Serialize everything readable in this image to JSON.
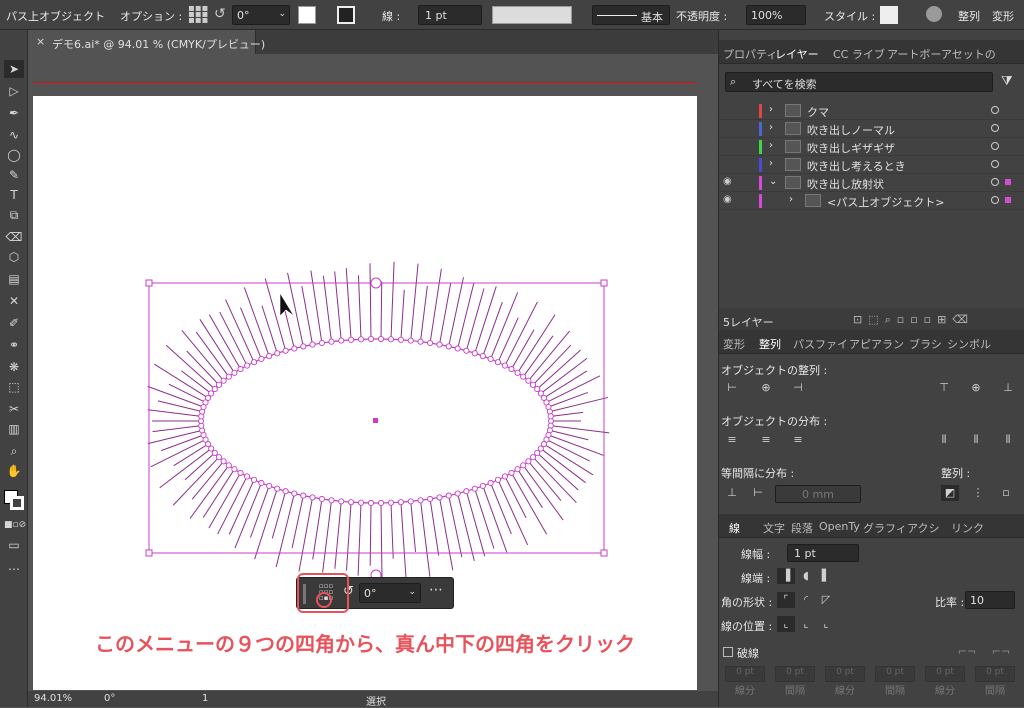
{
  "control_bar": {
    "mode": "パス上オブジェクト",
    "option_label": "オプション :",
    "rotation": "0°",
    "stroke_label": "線 :",
    "stroke_value": "1 pt",
    "brush": "基本",
    "opacity_label": "不透明度 :",
    "opacity": "100%",
    "style_label": "スタイル :",
    "align_label": "整列",
    "transform_label": "変形"
  },
  "document_tab": {
    "title": "デモ6.ai* @ 94.01 % (CMYK/プレビュー)"
  },
  "floating_toolbar": {
    "rotation": "0°"
  },
  "annotation": "このメニューの９つの四角から、真ん中下の四角をクリック",
  "status_bar": {
    "zoom": "94.01%",
    "angle": "0°",
    "artboard": "1",
    "tool": "選択"
  },
  "layers_panel": {
    "tabs": [
      "プロパティ",
      "レイヤー",
      "CC ライブ",
      "アートボー",
      "アセットの"
    ],
    "search_placeholder": "すべてを検索",
    "layers": [
      {
        "name": "クマ",
        "color": "#e04646"
      },
      {
        "name": "吹き出しノーマル",
        "color": "#4a67d6"
      },
      {
        "name": "吹き出しギザギザ",
        "color": "#3fd64a"
      },
      {
        "name": "吹き出し考えるとき",
        "color": "#4a4ad6"
      },
      {
        "name": "吹き出し放射状",
        "color": "#d64ad6"
      },
      {
        "name": "<パス上オブジェクト>",
        "color": "#d64ad6"
      }
    ],
    "count": "5レイヤー"
  },
  "align_panel": {
    "tabs": [
      "変形",
      "整列",
      "パスファイ",
      "アピアラン",
      "ブラシ",
      "シンボル"
    ],
    "align_objects": "オブジェクトの整列 :",
    "distribute_objects": "オブジェクトの分布 :",
    "distribute_spacing": "等間隔に分布 :",
    "align_to": "整列 :",
    "spacing_value": "0 mm"
  },
  "stroke_panel": {
    "tabs": [
      "線",
      "文字",
      "段落",
      "OpenTy",
      "グラフィ",
      "アクシ",
      "リンク"
    ],
    "weight_label": "線幅 :",
    "weight": "1 pt",
    "cap_label": "線端 :",
    "corner_label": "角の形状 :",
    "miter_label": "比率 :",
    "miter": "10",
    "align_label": "線の位置 :",
    "dashed": "破線",
    "dash_labels": [
      "線分",
      "間隔",
      "線分",
      "間隔",
      "線分",
      "間隔"
    ],
    "dash_values": [
      "0 pt",
      "0 pt",
      "0 pt",
      "0 pt",
      "0 pt",
      "0 pt"
    ]
  },
  "colors": {
    "selection": "#c83cc8",
    "annotation": "#e8525a",
    "guide": "#e01010"
  }
}
